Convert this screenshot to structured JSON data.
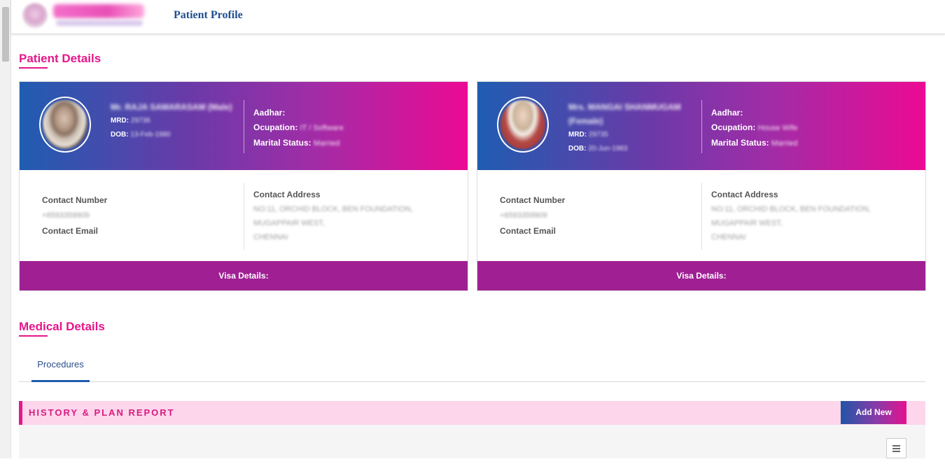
{
  "header": {
    "page_title": "Patient Profile"
  },
  "patient_details": {
    "title": "Patient Details",
    "cards": [
      {
        "name": "Mr. RAJA SAMARASAM (Male)",
        "mrd_label": "MRD:",
        "mrd": "29736",
        "dob_label": "DOB:",
        "dob": "13-Feb-1980",
        "aadhar_label": "Aadhar:",
        "occupation_label": "Ocupation:",
        "occupation": "IT / Software",
        "marital_label": "Marital Status:",
        "marital": "Married",
        "contact_number_label": "Contact Number",
        "contact_number": "+6593359909",
        "contact_email_label": "Contact Email",
        "contact_address_label": "Contact Address",
        "address_lines": [
          "NO:11, ORCHID BLOCK, BEN FOUNDATION,",
          "MUGAPPAIR WEST,",
          "CHENNAI"
        ],
        "visa_label": "Visa Details:"
      },
      {
        "name": "Mrs. MANGAI SHANMUGAM (Female)",
        "mrd_label": "MRD:",
        "mrd": "29735",
        "dob_label": "DOB:",
        "dob": "20-Jun-1983",
        "aadhar_label": "Aadhar:",
        "occupation_label": "Ocupation:",
        "occupation": "House Wife",
        "marital_label": "Marital Status:",
        "marital": "Married",
        "contact_number_label": "Contact Number",
        "contact_number": "+6593359909",
        "contact_email_label": "Contact Email",
        "contact_address_label": "Contact Address",
        "address_lines": [
          "NO:11, ORCHID BLOCK, BEN FOUNDATION,",
          "MUGAPPAIR WEST,",
          "CHENNAI"
        ],
        "visa_label": "Visa Details:"
      }
    ]
  },
  "medical_details": {
    "title": "Medical Details",
    "tabs": [
      {
        "label": "Procedures"
      }
    ],
    "history_title": "HISTORY & PLAN REPORT",
    "add_new_label": "Add New"
  },
  "colors": {
    "accent_pink": "#e6168b",
    "visa_purple": "#a02094",
    "title_blue": "#1f4f8f"
  }
}
